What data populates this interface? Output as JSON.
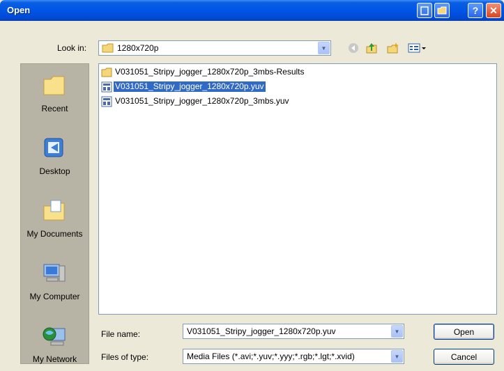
{
  "window": {
    "title": "Open"
  },
  "toolbar": {
    "look_in_label": "Look in:",
    "look_in_value": "1280x720p"
  },
  "places": [
    {
      "label": "Recent"
    },
    {
      "label": "Desktop"
    },
    {
      "label": "My Documents"
    },
    {
      "label": "My Computer"
    },
    {
      "label": "My Network"
    }
  ],
  "files": [
    {
      "name": "V031051_Stripy_jogger_1280x720p_3mbs-Results",
      "type": "folder"
    },
    {
      "name": "V031051_Stripy_jogger_1280x720p.yuv",
      "type": "yuv-file",
      "selected": true
    },
    {
      "name": "V031051_Stripy_jogger_1280x720p_3mbs.yuv",
      "type": "yuv-file"
    }
  ],
  "file_name": {
    "label": "File name:",
    "value": "V031051_Stripy_jogger_1280x720p.yuv"
  },
  "file_type": {
    "label": "Files of type:",
    "value": "Media Files (*.avi;*.yuv;*.yyy;*.rgb;*.lgt;*.xvid)"
  },
  "buttons": {
    "open": "Open",
    "cancel": "Cancel"
  },
  "colors": {
    "titlebar": "#0055e5",
    "selection": "#316ac5",
    "dialog_bg": "#ece9d8",
    "places_bg": "#b7b4a5"
  }
}
